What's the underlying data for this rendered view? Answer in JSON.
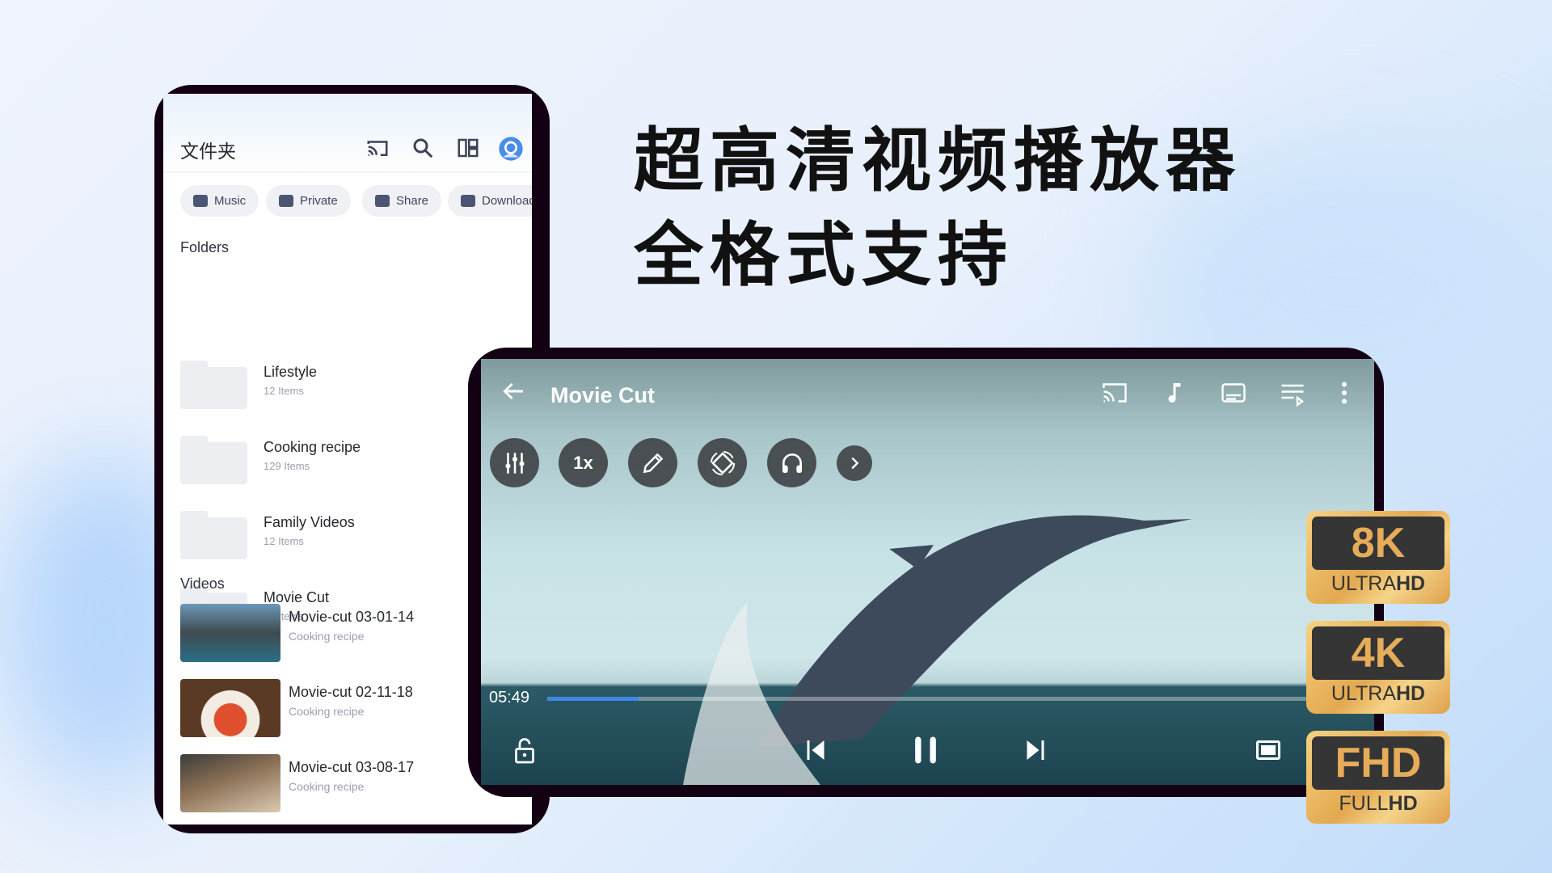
{
  "headline": {
    "line1": "超高清视频播放器",
    "line2": "全格式支持"
  },
  "phone": {
    "title": "文件夹",
    "header_icons": [
      "cast-icon",
      "search-icon",
      "layout-icon",
      "profile-icon"
    ],
    "chips": [
      {
        "label": "Music",
        "icon": "music-folder-icon"
      },
      {
        "label": "Private",
        "icon": "lock-folder-icon"
      },
      {
        "label": "Share",
        "icon": "share-icon"
      },
      {
        "label": "Downloaded",
        "icon": "download-folder-icon"
      }
    ],
    "folders_label": "Folders",
    "folders": [
      {
        "name": "Lifestyle",
        "count": "12 Items"
      },
      {
        "name": "Cooking recipe",
        "count": "129 Items"
      },
      {
        "name": "Family Videos",
        "count": "12 Items"
      },
      {
        "name": "Movie Cut",
        "count": "13 Items"
      }
    ],
    "videos_label": "Videos",
    "videos": [
      {
        "name": "Movie-cut 03-01-14",
        "folder": "Cooking recipe"
      },
      {
        "name": "Movie-cut 02-11-18",
        "folder": "Cooking recipe"
      },
      {
        "name": "Movie-cut 03-08-17",
        "folder": "Cooking recipe"
      }
    ]
  },
  "player": {
    "title": "Movie Cut",
    "speed_label": "1x",
    "current_time": "05:49",
    "progress_percent": 11,
    "accent": "#3f86e6"
  },
  "badges": [
    {
      "big": "8K",
      "small_a": "ULTRA",
      "small_b": "HD"
    },
    {
      "big": "4K",
      "small_a": "ULTRA",
      "small_b": "HD"
    },
    {
      "big": "FHD",
      "small_a": "FULL",
      "small_b": "HD"
    }
  ]
}
